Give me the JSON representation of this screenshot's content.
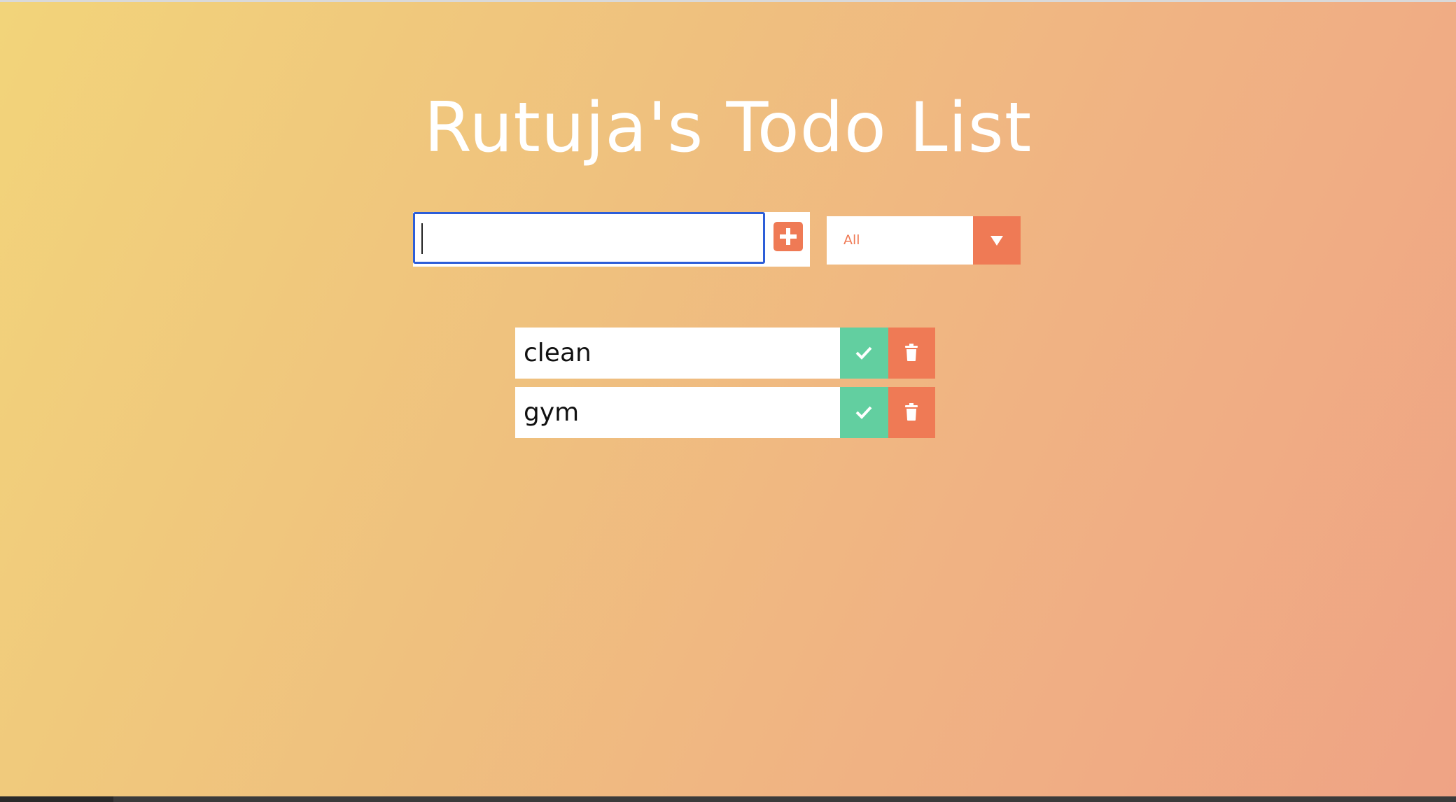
{
  "header": {
    "title": "Rutuja's Todo List"
  },
  "form": {
    "input_value": "",
    "add_icon": "plus-icon",
    "filter": {
      "selected": "All",
      "arrow_icon": "caret-down-icon"
    }
  },
  "todos": [
    {
      "text": "clean",
      "complete_icon": "check-icon",
      "delete_icon": "trash-icon"
    },
    {
      "text": "gym",
      "complete_icon": "check-icon",
      "delete_icon": "trash-icon"
    }
  ],
  "colors": {
    "accent": "#ef7a55",
    "complete": "#62cfa0",
    "focus": "#2d5ed8",
    "gradient_start": "#f2d47a",
    "gradient_end": "#efa385"
  }
}
